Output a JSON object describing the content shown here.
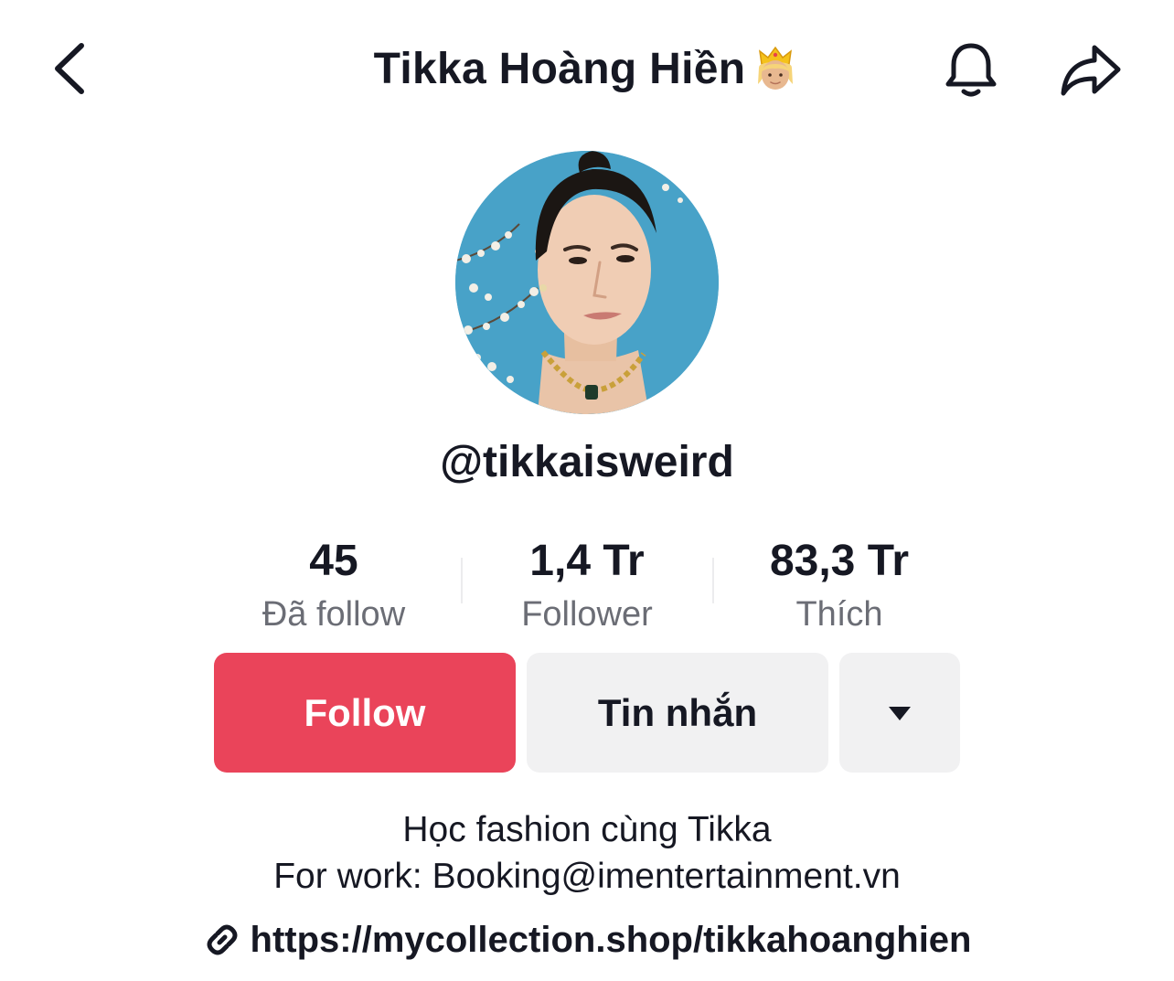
{
  "header": {
    "title": "Tikka Hoàng Hiền",
    "title_emoji": "crown-princess-emoji",
    "back_icon": "chevron-left-icon",
    "bell_icon": "bell-icon",
    "share_icon": "share-arrow-icon"
  },
  "profile": {
    "handle": "@tikkaisweird",
    "avatar": "avatar"
  },
  "stats": [
    {
      "value": "45",
      "label": "Đã follow"
    },
    {
      "value": "1,4 Tr",
      "label": "Follower"
    },
    {
      "value": "83,3 Tr",
      "label": "Thích"
    }
  ],
  "actions": {
    "follow_label": "Follow",
    "message_label": "Tin nhắn",
    "more_icon": "triangle-down-icon"
  },
  "bio": {
    "line1": "Học fashion cùng Tikka",
    "line2": "For work: Booking@imentertainment.vn"
  },
  "link": {
    "icon": "link-icon",
    "text": "https://mycollection.shop/tikkahoanghien"
  },
  "colors": {
    "follow_bg": "#ea445a",
    "secondary_btn_bg": "#f1f1f2",
    "text_primary": "#161823",
    "text_secondary": "#6b6d75"
  }
}
